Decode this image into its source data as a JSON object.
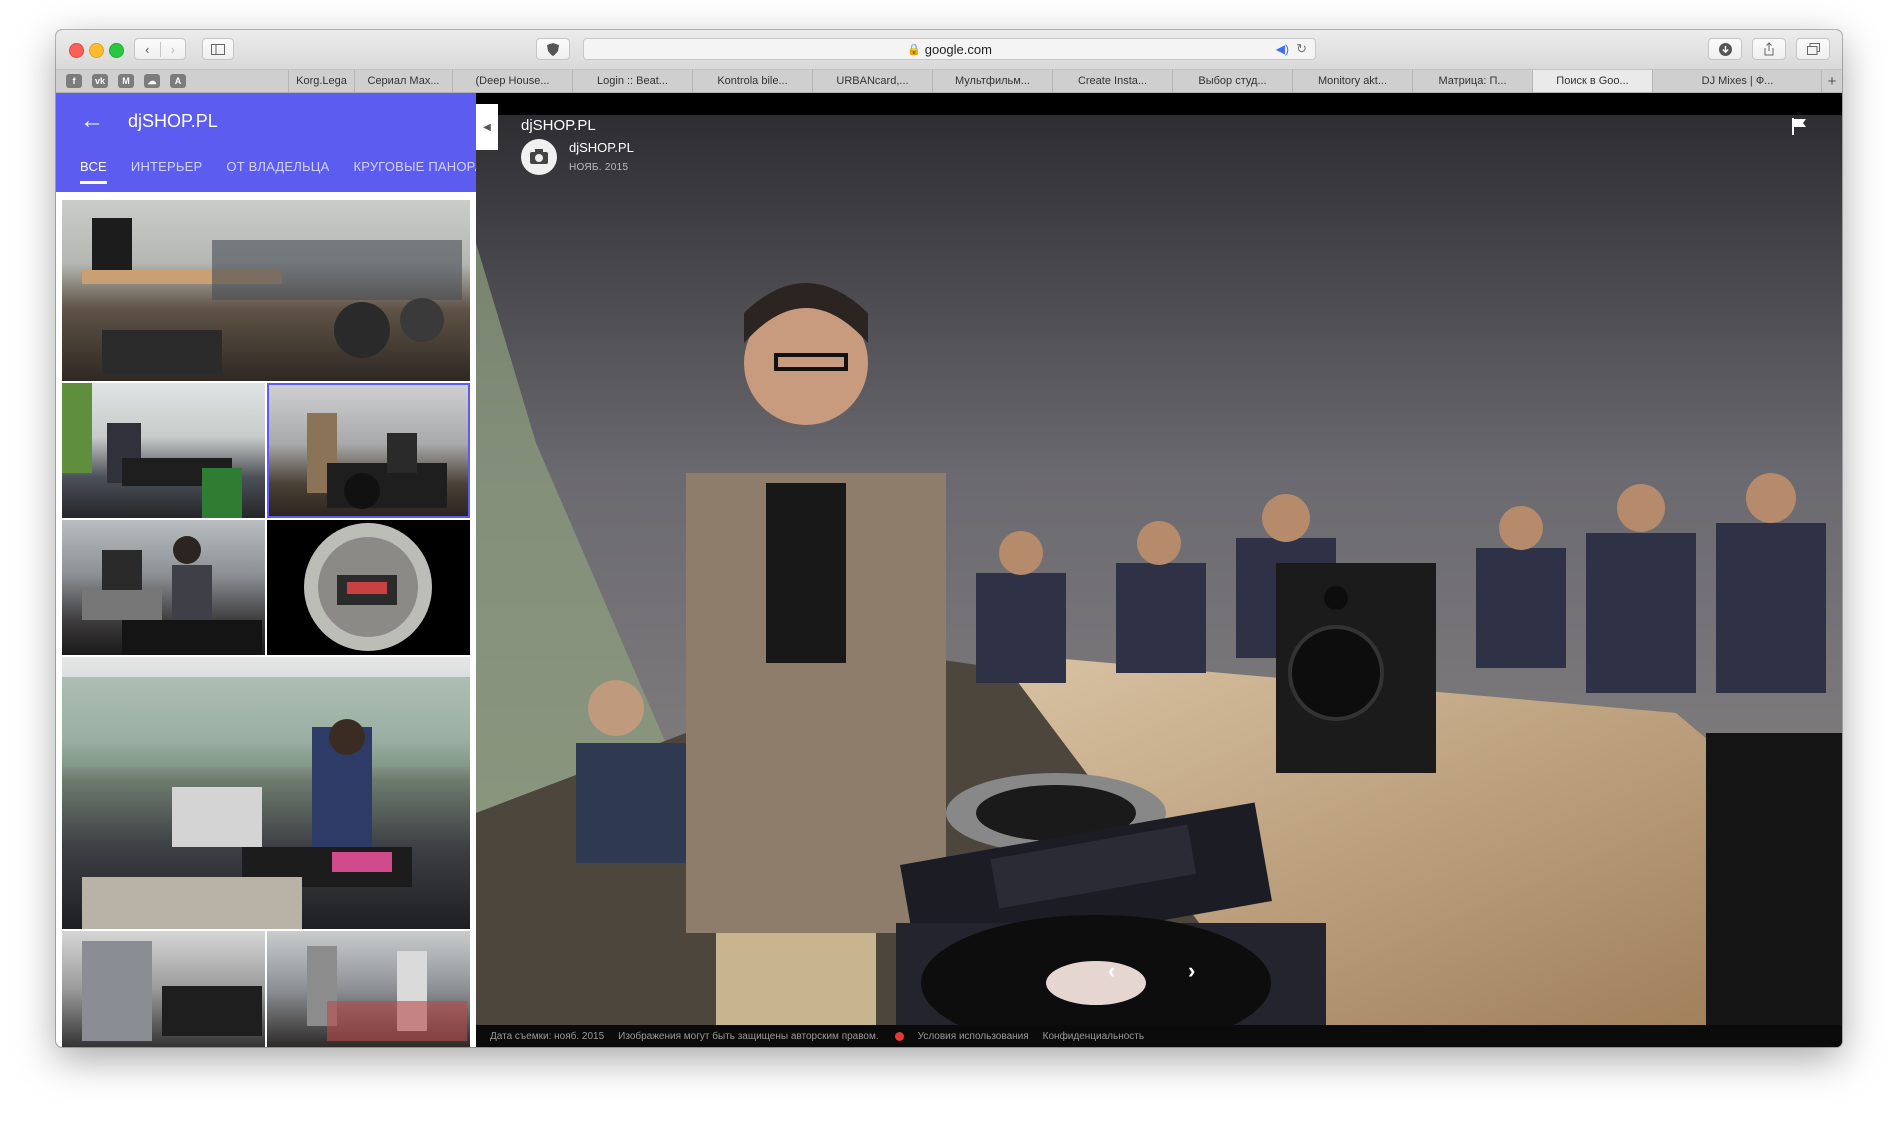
{
  "browser": {
    "address": "google.com",
    "tabs": [
      "Korg.Lega",
      "Сериал Мах...",
      "(Deep House...",
      "Login :: Beat...",
      "Kontrola bile...",
      "URBANcard,...",
      "Мультфильм...",
      "Create Insta...",
      "Выбор студ...",
      "Monitory akt...",
      "Матрица: П...",
      "Поиск в Goo...",
      "DJ Mixes | Ф..."
    ],
    "active_tab_index": 11,
    "new_tab_symbol": "+",
    "bookmark_icons": [
      "F",
      "VK",
      "M",
      "SC",
      "A"
    ]
  },
  "panel": {
    "title": "djSHOP.PL",
    "categories": [
      "ВСЕ",
      "ИНТЕРЬЕР",
      "ОТ ВЛАДЕЛЬЦА",
      "КРУГОВЫЕ ПАНОРАМЫ"
    ],
    "active_category": "ВСЕ",
    "thumbnail_count": 8,
    "selected_thumbnail": 3
  },
  "viewer": {
    "title": "djSHOP.PL",
    "author": "djSHOP.PL",
    "date": "НОЯБ. 2015"
  },
  "footer": {
    "capture_date": "Дата съемки: нояб. 2015",
    "copyright": "Изображения могут быть защищены авторским правом.",
    "terms": "Условия использования",
    "privacy": "Конфиденциальность"
  },
  "colors": {
    "accent": "#5c5cf0",
    "viewer_bg": "#000000"
  }
}
